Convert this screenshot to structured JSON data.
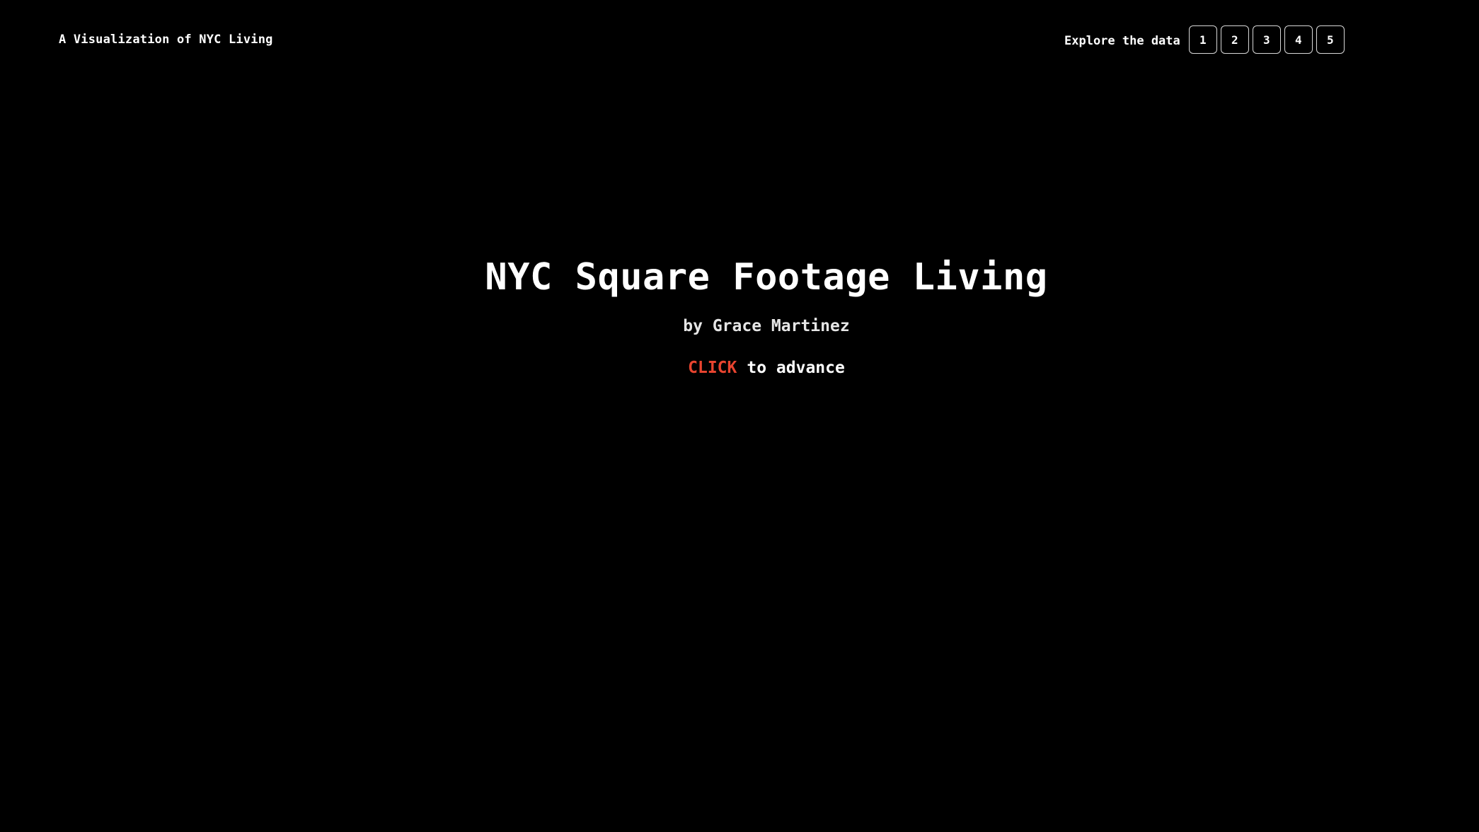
{
  "header": {
    "site_label": "A Visualization of NYC Living",
    "nav_label": "Explore the data",
    "nav_buttons": [
      "1",
      "2",
      "3",
      "4",
      "5"
    ]
  },
  "hero": {
    "title": "NYC Square Footage Living",
    "byline": "by Grace Martinez",
    "cta_action": "CLICK",
    "cta_rest": "to advance"
  },
  "colors": {
    "background": "#000000",
    "text": "#ffffff",
    "accent": "#e8442f"
  }
}
